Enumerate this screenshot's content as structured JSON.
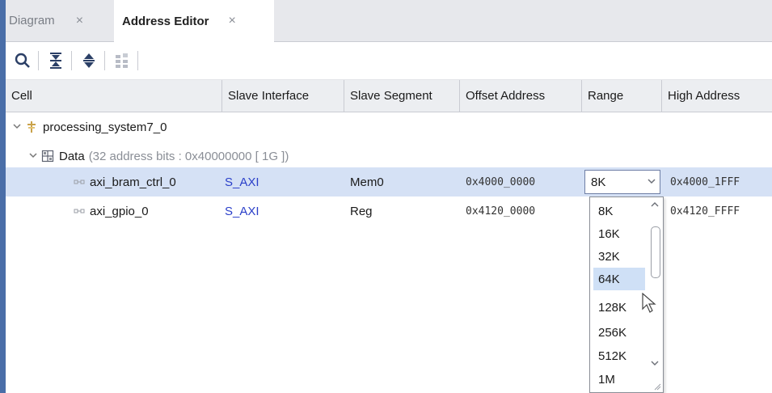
{
  "tabs": [
    {
      "label": "Diagram",
      "close": "×"
    },
    {
      "label": "Address Editor",
      "close": "×"
    }
  ],
  "toolbar": {
    "icons": [
      "search-icon",
      "collapse-all-icon",
      "expand-all-icon",
      "auto-assign-icon"
    ]
  },
  "columns": [
    "Cell",
    "Slave Interface",
    "Slave Segment",
    "Offset Address",
    "Range",
    "High Address"
  ],
  "tree": {
    "root": {
      "label": "processing_system7_0"
    },
    "data_group": {
      "label": "Data",
      "note": "(32 address bits : 0x40000000 [ 1G ])"
    },
    "rows": [
      {
        "cell": "axi_bram_ctrl_0",
        "slave_interface": "S_AXI",
        "slave_segment": "Mem0",
        "offset_address": "0x4000_0000",
        "range": "8K",
        "high_address": "0x4000_1FFF"
      },
      {
        "cell": "axi_gpio_0",
        "slave_interface": "S_AXI",
        "slave_segment": "Reg",
        "offset_address": "0x4120_0000",
        "range": "",
        "high_address": "0x4120_FFFF"
      }
    ]
  },
  "range_dropdown": {
    "selected": "8K",
    "options": [
      "8K",
      "16K",
      "32K",
      "64K",
      "128K",
      "256K",
      "512K",
      "1M"
    ],
    "highlighted": "64K"
  },
  "colors": {
    "selected_row": "#d5e1f5",
    "interface_link": "#2a3fc9",
    "highlight": "#cfe0f6"
  }
}
